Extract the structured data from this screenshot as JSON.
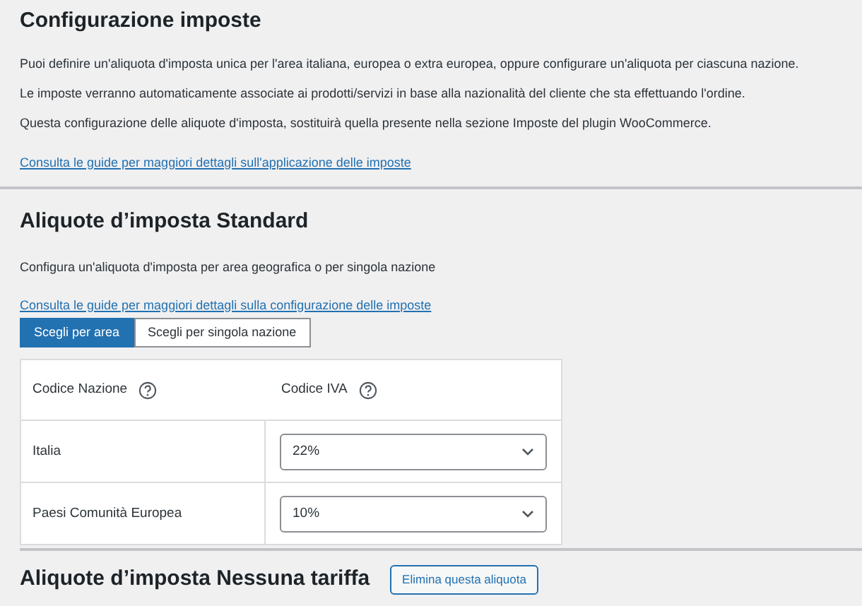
{
  "sections": [
    {
      "kind": "intro",
      "title": "Configurazione imposte",
      "paragraphs": [
        "Puoi definire un'aliquota d'imposta unica per l'area italiana, europea o extra europea, oppure configurare un'aliquota per ciascuna nazione.",
        "Le imposte verranno automaticamente associate ai prodotti/servizi in base alla nazionalità del cliente che sta effettuando l'ordine.",
        "Questa configurazione delle aliquote d'imposta, sostituirà quella presente nella sezione Imposte del plugin WooCommerce."
      ],
      "link": "Consulta le guide per maggiori dettagli sull'applicazione delle imposte"
    },
    {
      "kind": "rates",
      "title": "Aliquote d’imposta Standard",
      "paragraphs": [
        "Configura un'aliquota d'imposta per area geografica o per singola nazione"
      ],
      "link": "Consulta le guide per maggiori dettagli sulla configurazione delle imposte",
      "tabs": [
        {
          "label": "Scegli per area",
          "selected": true
        },
        {
          "label": "Scegli per singola nazione",
          "selected": false
        }
      ],
      "table": {
        "columns": [
          "Codice Nazione",
          "Codice IVA"
        ],
        "rows": [
          {
            "name": "Italia",
            "value": "22%"
          },
          {
            "name": "Paesi Comunità Europea",
            "value": "10%"
          }
        ]
      }
    },
    {
      "kind": "heading",
      "title": "Aliquote d’imposta Nessuna tariffa",
      "button": "Elimina questa aliquota"
    }
  ]
}
